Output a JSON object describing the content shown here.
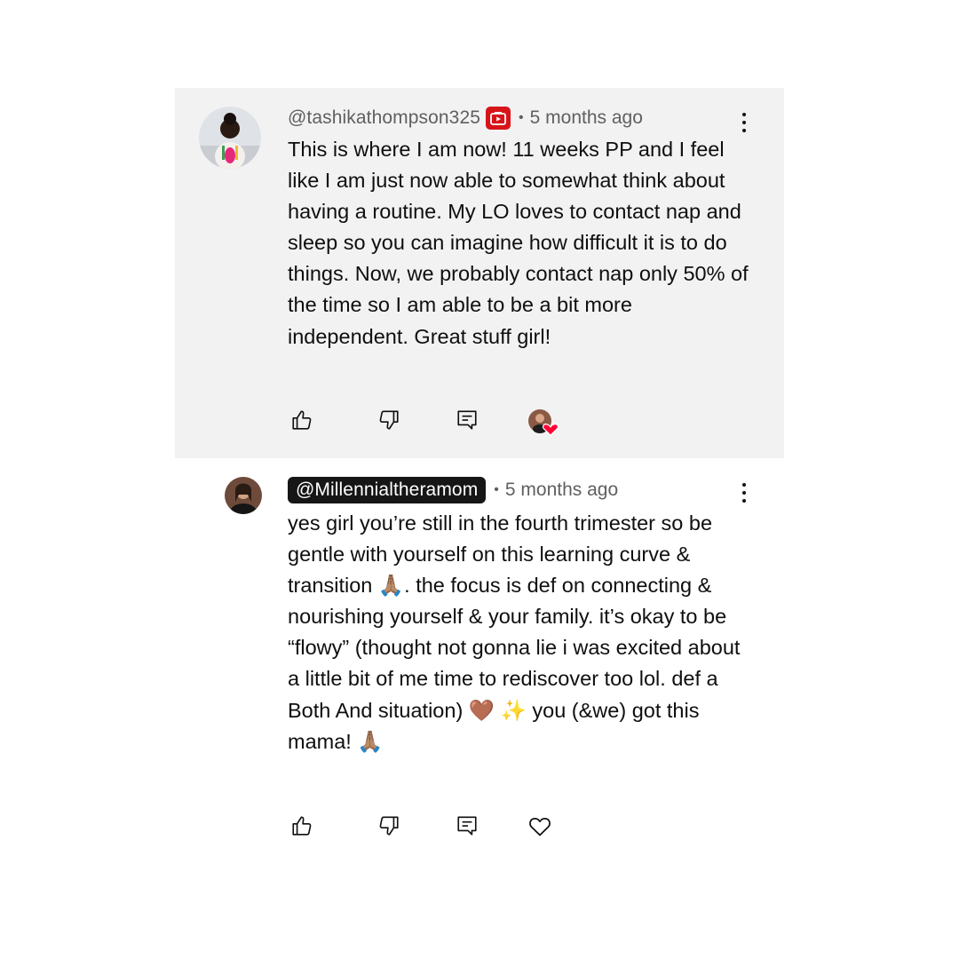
{
  "comments": [
    {
      "author": "@tashikathompson325",
      "has_member_badge": true,
      "time": "5 months ago",
      "text": "This is where I am now! 11 weeks PP and I feel like I am just now able to somewhat think about having a routine. My LO loves to contact nap and sleep so you can imagine how difficult it is to do things. Now, we probably contact nap only 50% of the time so I am able to be a bit more independent. Great stuff girl!",
      "creator_hearted": true,
      "icons": [
        "thumb-up-icon",
        "thumb-down-icon",
        "reply-icon",
        "creator-heart-icon"
      ],
      "colors": {
        "background": "#f2f2f2",
        "badge": "#d8141b",
        "heart": "#ff0033"
      }
    },
    {
      "author": "@Millennialtheramom",
      "is_creator": true,
      "time": "5 months ago",
      "text": "yes girl you’re still in the fourth trimester so be gentle with yourself on this learning curve & transition 🙏🏽. the focus is def on connecting & nourishing yourself & your family. it’s okay to be “flowy” (thought not gonna lie i was excited about a little bit of me time to rediscover too lol. def a Both And situation) 🤎 ✨ you (&we) got this mama! 🙏🏽",
      "creator_hearted": false,
      "icons": [
        "thumb-up-icon",
        "thumb-down-icon",
        "reply-icon",
        "heart-outline-icon"
      ],
      "colors": {
        "background": "#ffffff",
        "creator_chip": "#161616"
      }
    }
  ],
  "separator": "•"
}
